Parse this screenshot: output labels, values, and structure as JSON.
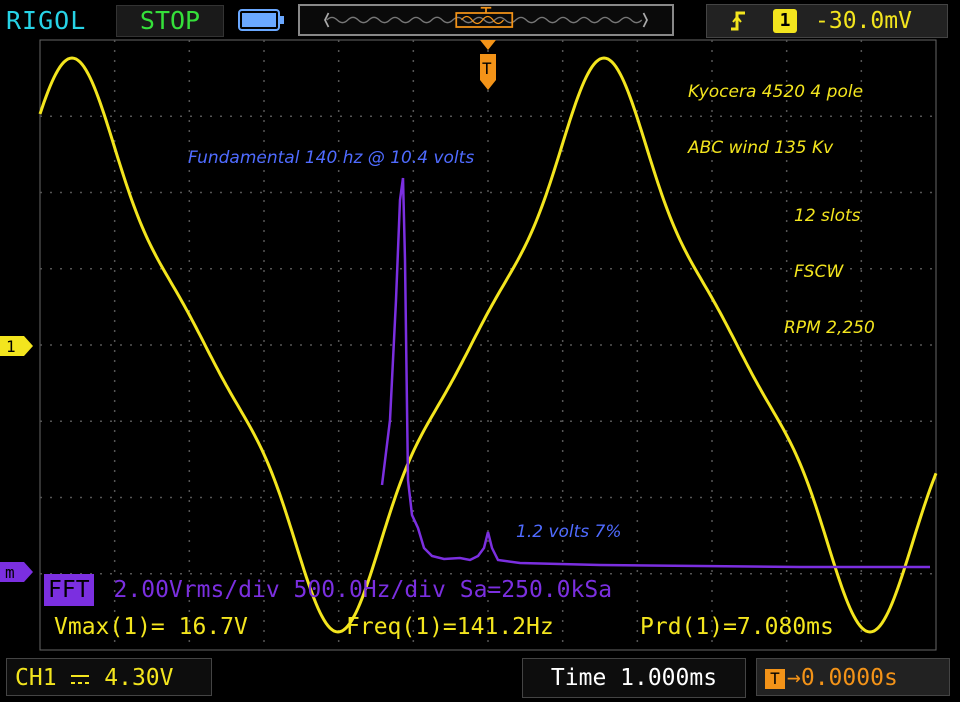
{
  "header": {
    "brand": "RIGOL",
    "run_state": "STOP",
    "trigger": {
      "channel": "1",
      "level": "-30.0mV"
    }
  },
  "annotations": {
    "fundamental": "Fundamental 140 hz @ 10.4 volts",
    "harmonic": "1.2 volts 7%",
    "motor": [
      "Kyocera 4520 4 pole",
      "ABC wind  135 Kv",
      "12 slots",
      "FSCW",
      "RPM 2,250"
    ]
  },
  "markers": {
    "ch1": "1",
    "math": "m",
    "trigger_pos": "T"
  },
  "fft": {
    "label": "FFT",
    "info": "2.00Vrms/div 500.0Hz/div Sa=250.0kSa"
  },
  "measurements": {
    "vmax": "Vmax(1)= 16.7V",
    "freq": "Freq(1)=141.2Hz",
    "prd": "Prd(1)=7.080ms"
  },
  "footer": {
    "ch1_scale": "CH1⎓  4.30V",
    "ch1_label": "CH1",
    "ch1_value": "4.30V",
    "time": "Time 1.000ms",
    "offset": "0.0000s"
  },
  "colors": {
    "ch1": "#f3e51e",
    "math": "#7b2fe0",
    "trigger": "#f39318",
    "brand": "#27d3e6",
    "stop": "#35e03a",
    "annotation_blue": "#4f6bff"
  }
}
